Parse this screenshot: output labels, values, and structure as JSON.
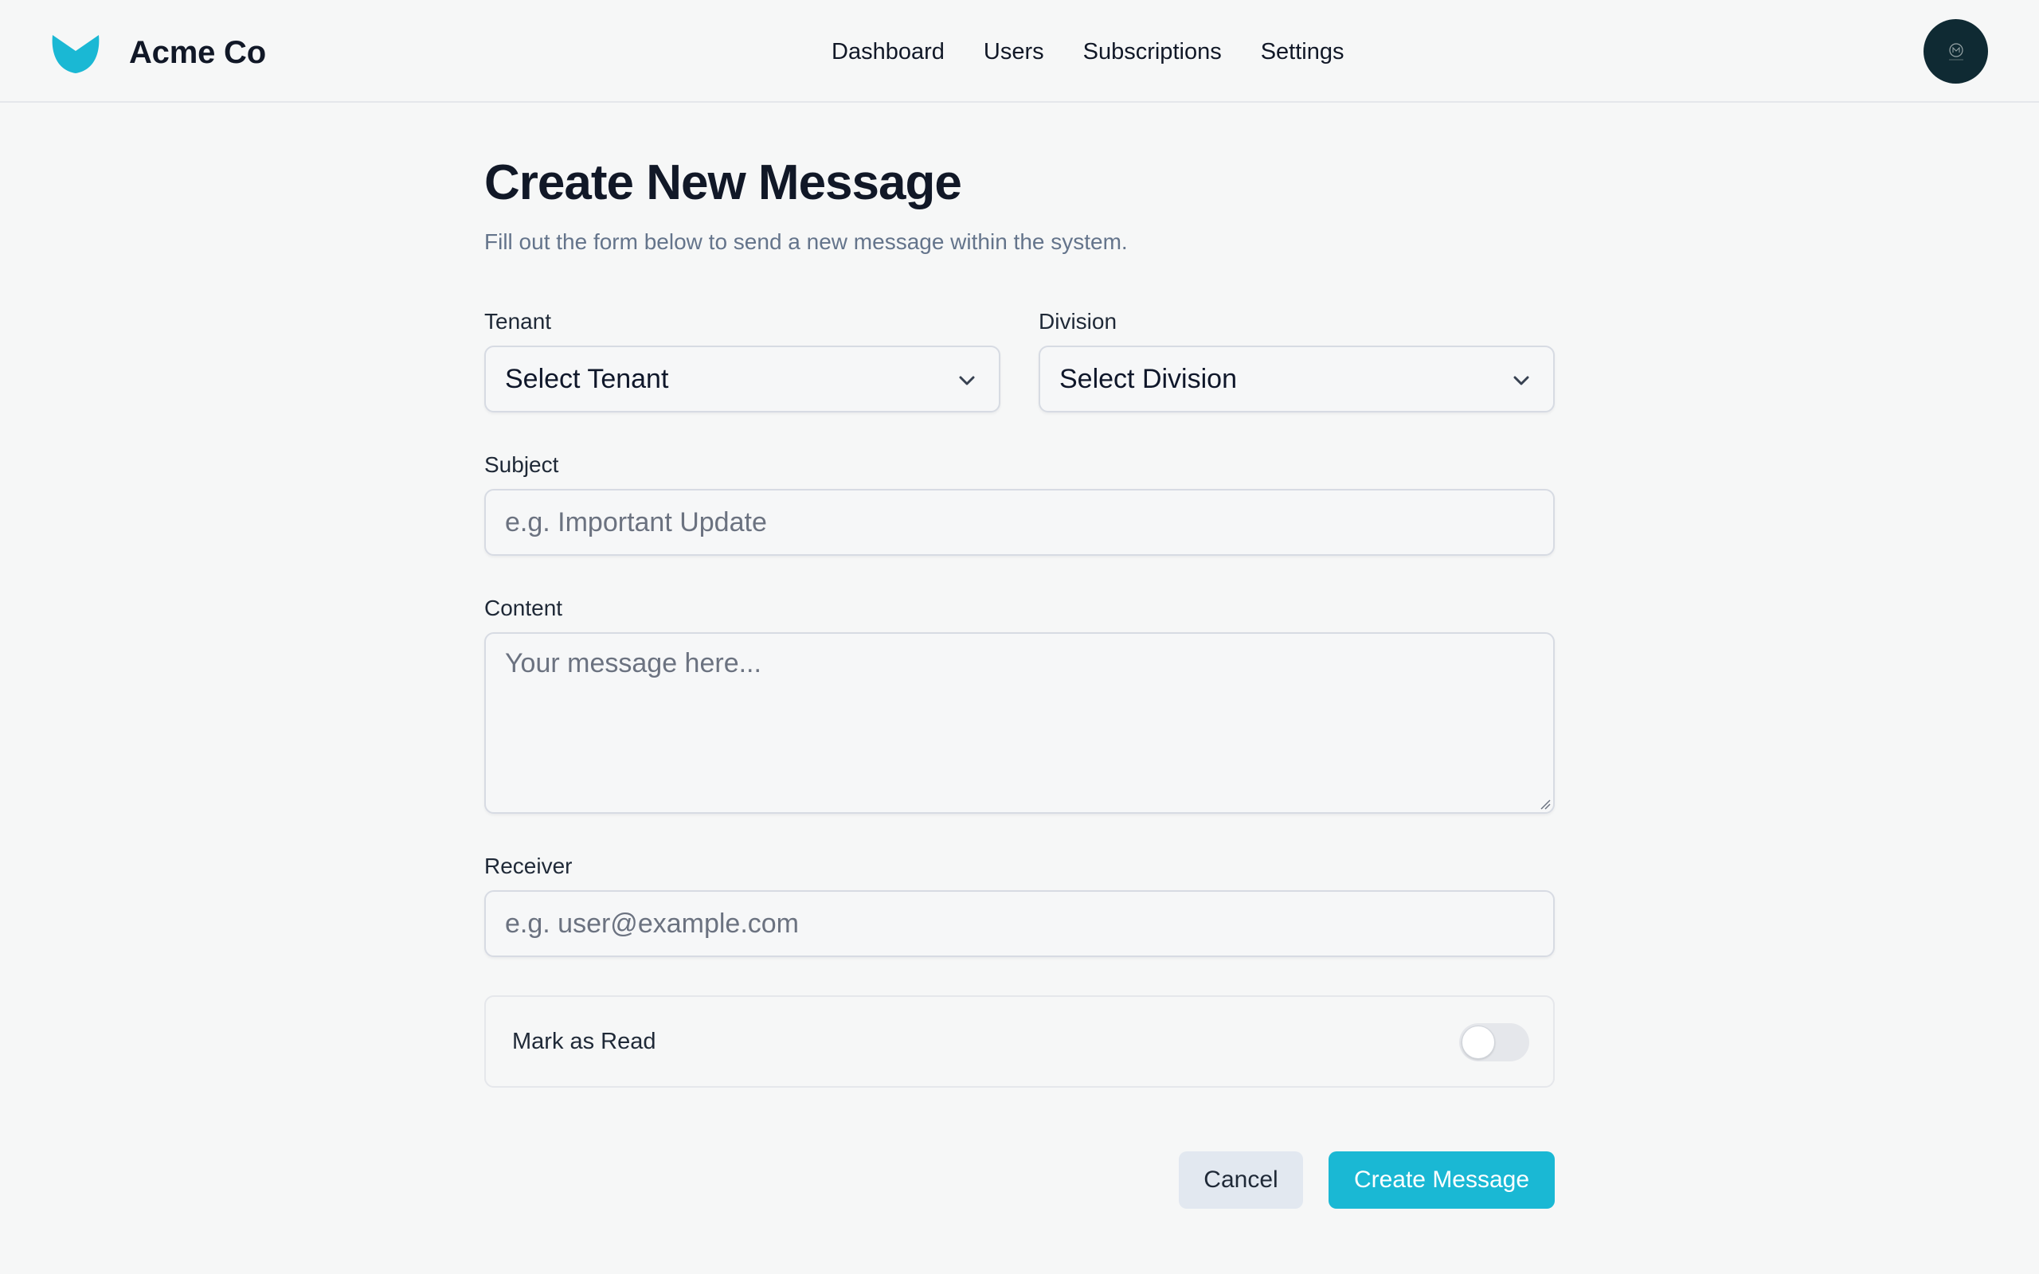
{
  "header": {
    "brand_name": "Acme Co",
    "logo_icon": "acme-logo-icon",
    "nav": [
      {
        "label": "Dashboard"
      },
      {
        "label": "Users"
      },
      {
        "label": "Subscriptions"
      },
      {
        "label": "Settings"
      }
    ],
    "avatar_icon": "user-avatar-icon"
  },
  "form": {
    "title": "Create New Message",
    "subtitle": "Fill out the form below to send a new message within the system.",
    "tenant": {
      "label": "Tenant",
      "value": "Select Tenant"
    },
    "division": {
      "label": "Division",
      "value": "Select Division"
    },
    "subject": {
      "label": "Subject",
      "placeholder": "e.g. Important Update",
      "value": ""
    },
    "content": {
      "label": "Content",
      "placeholder": "Your message here...",
      "value": ""
    },
    "receiver": {
      "label": "Receiver",
      "placeholder": "e.g. user@example.com",
      "value": ""
    },
    "mark_as_read": {
      "label": "Mark as Read",
      "on": false
    },
    "cancel_label": "Cancel",
    "submit_label": "Create Message"
  },
  "colors": {
    "accent": "#1ab8d4",
    "background": "#f6f7f7",
    "avatar_bg": "#0f2a33",
    "cancel_bg": "#e2e8f0"
  }
}
